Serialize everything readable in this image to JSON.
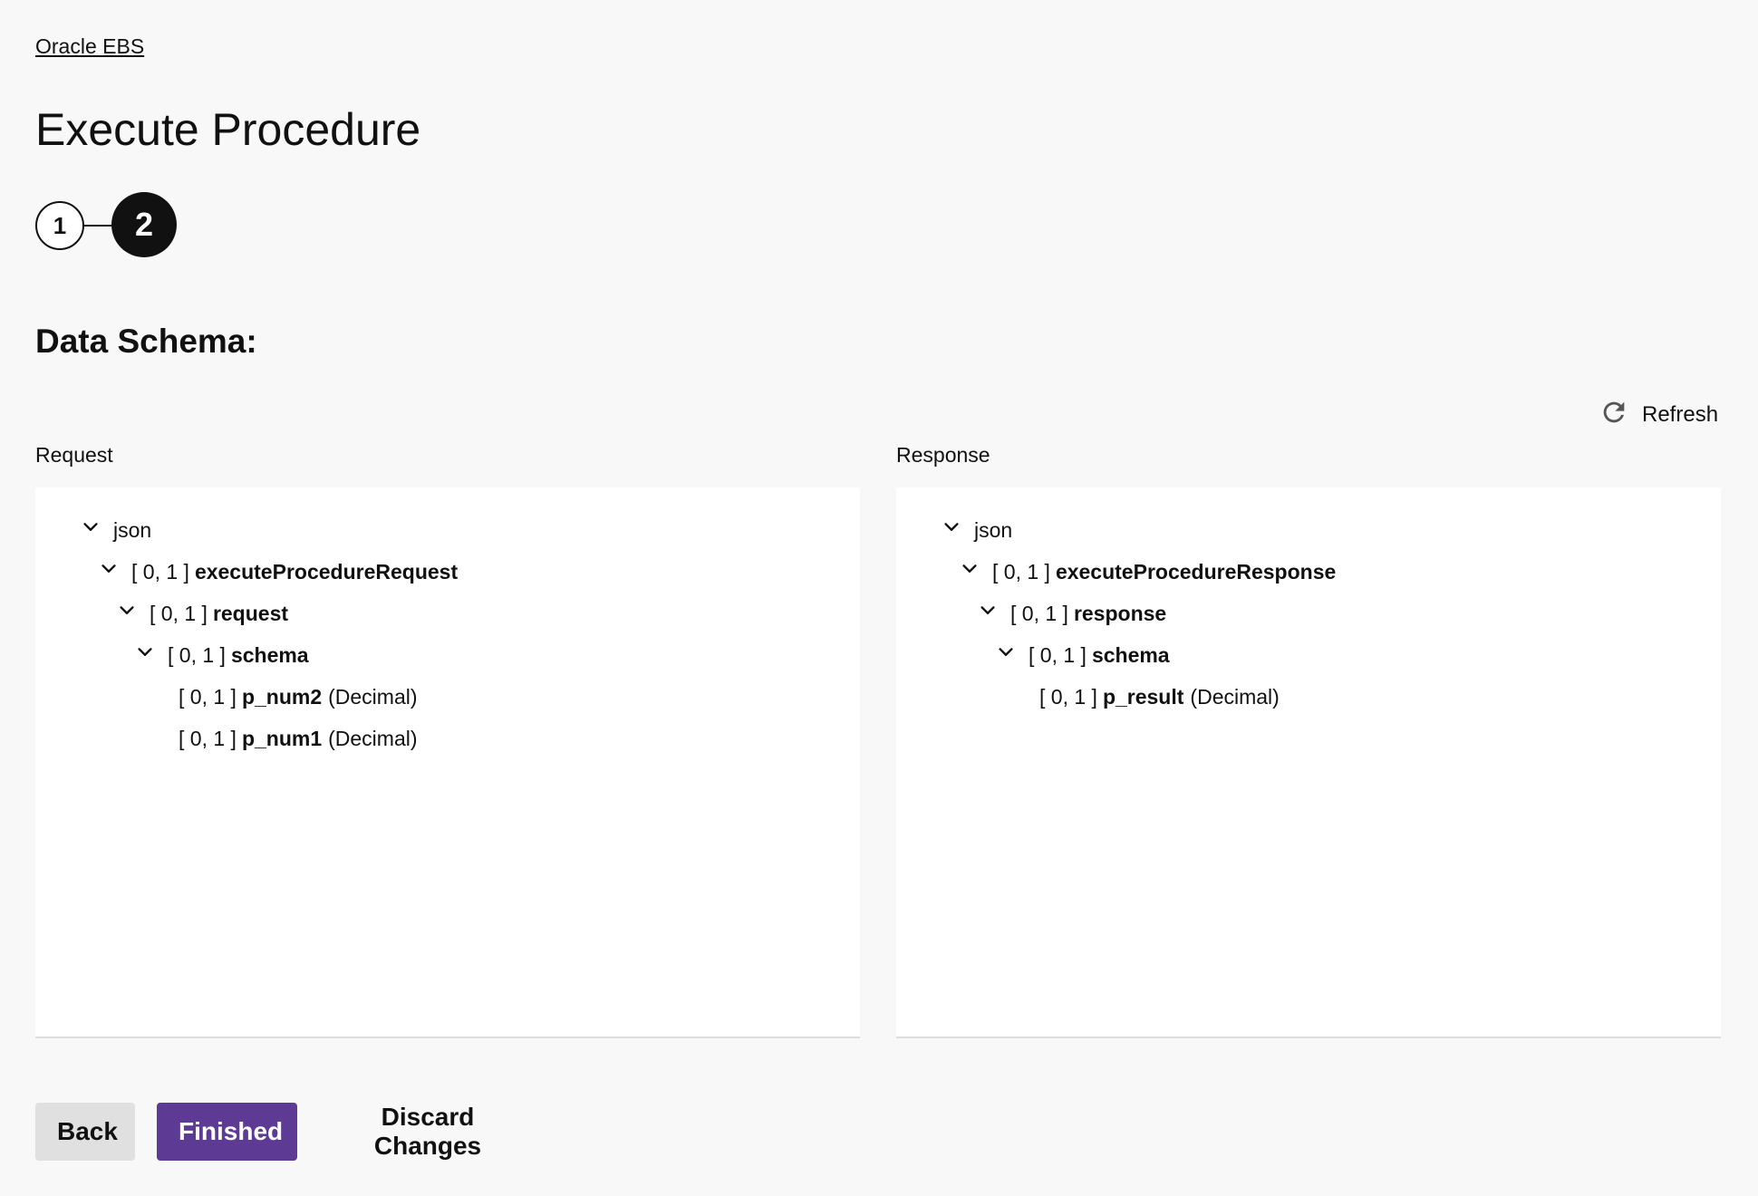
{
  "breadcrumb": "Oracle EBS",
  "page_title": "Execute Procedure",
  "stepper": {
    "steps": [
      "1",
      "2"
    ],
    "active_step": "2"
  },
  "section_title": "Data Schema:",
  "refresh_label": "Refresh",
  "request": {
    "label": "Request",
    "tree": [
      {
        "text": "json",
        "expanded": true
      },
      {
        "card": "[ 0, 1 ]",
        "name": "executeProcedureRequest",
        "expanded": true
      },
      {
        "card": "[ 0, 1 ]",
        "name": "request",
        "expanded": true
      },
      {
        "card": "[ 0, 1 ]",
        "name": "schema",
        "expanded": true
      },
      {
        "card": "[ 0, 1 ]",
        "name": "p_num2",
        "type": "(Decimal)"
      },
      {
        "card": "[ 0, 1 ]",
        "name": "p_num1",
        "type": "(Decimal)"
      }
    ]
  },
  "response": {
    "label": "Response",
    "tree": [
      {
        "text": "json",
        "expanded": true
      },
      {
        "card": "[ 0, 1 ]",
        "name": "executeProcedureResponse",
        "expanded": true
      },
      {
        "card": "[ 0, 1 ]",
        "name": "response",
        "expanded": true
      },
      {
        "card": "[ 0, 1 ]",
        "name": "schema",
        "expanded": true
      },
      {
        "card": "[ 0, 1 ]",
        "name": "p_result",
        "type": "(Decimal)"
      }
    ]
  },
  "buttons": {
    "back": "Back",
    "finished": "Finished",
    "discard": "Discard Changes"
  },
  "colors": {
    "primary": "#5d3a94",
    "secondary_button": "#e0e0e0",
    "background": "#f8f8f8"
  },
  "icons": {
    "refresh": "refresh-icon",
    "expand": "chevron-down-icon"
  }
}
